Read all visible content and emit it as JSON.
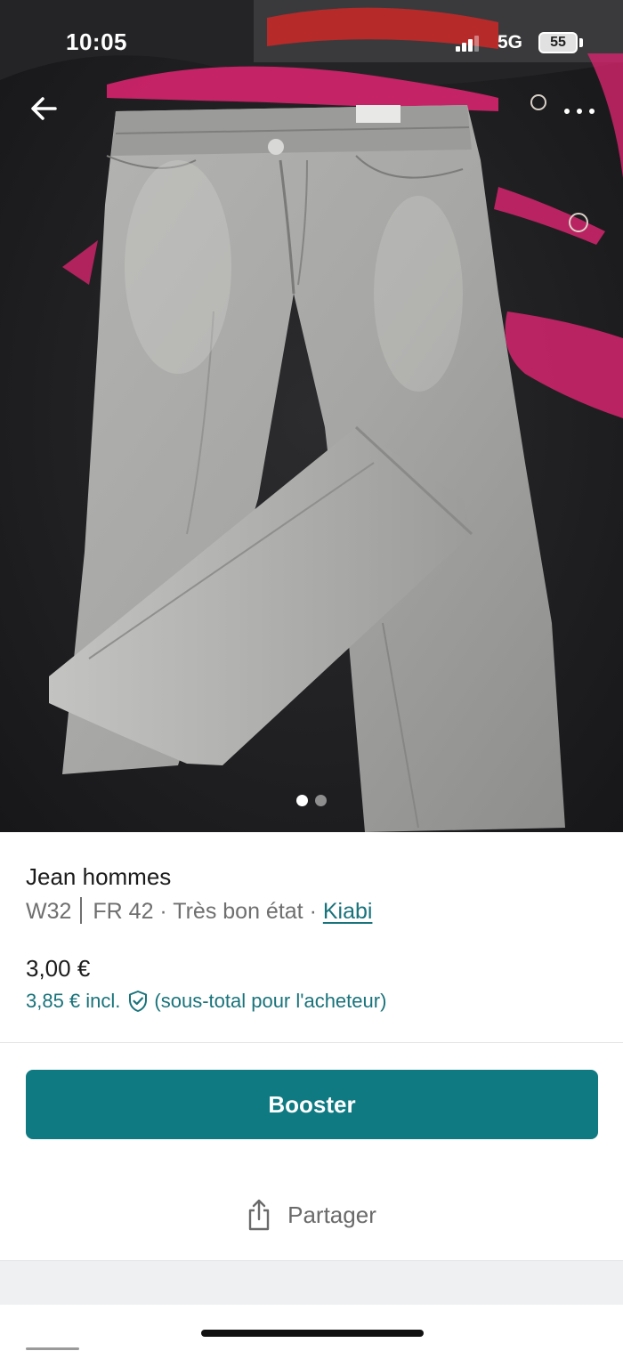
{
  "status_bar": {
    "time": "10:05",
    "network": "5G",
    "battery": "55"
  },
  "photo": {
    "pager_total": 2,
    "pager_active": 1,
    "pager_active_color": "#ffffff",
    "pager_inactive_color": "#8e8e8e"
  },
  "icons": {
    "back": "arrow-left-icon",
    "more": "more-horizontal-icon",
    "buyer_protection": "shield-check-icon",
    "share": "share-upload-icon"
  },
  "item": {
    "title": "Jean hommes",
    "size": "W32",
    "size_fr": "FR 42 · Très bon état · ",
    "brand": "Kiabi",
    "price": "3,00 €",
    "price_incl": "3,85 € incl.",
    "price_incl_note": "(sous-total pour l'acheteur)"
  },
  "actions": {
    "booster_label": "Booster",
    "share_label": "Partager"
  },
  "colors": {
    "accent": "#0f7a82",
    "link": "#19737b",
    "text": "#1b1b1b",
    "muted": "#6f6f6f"
  }
}
